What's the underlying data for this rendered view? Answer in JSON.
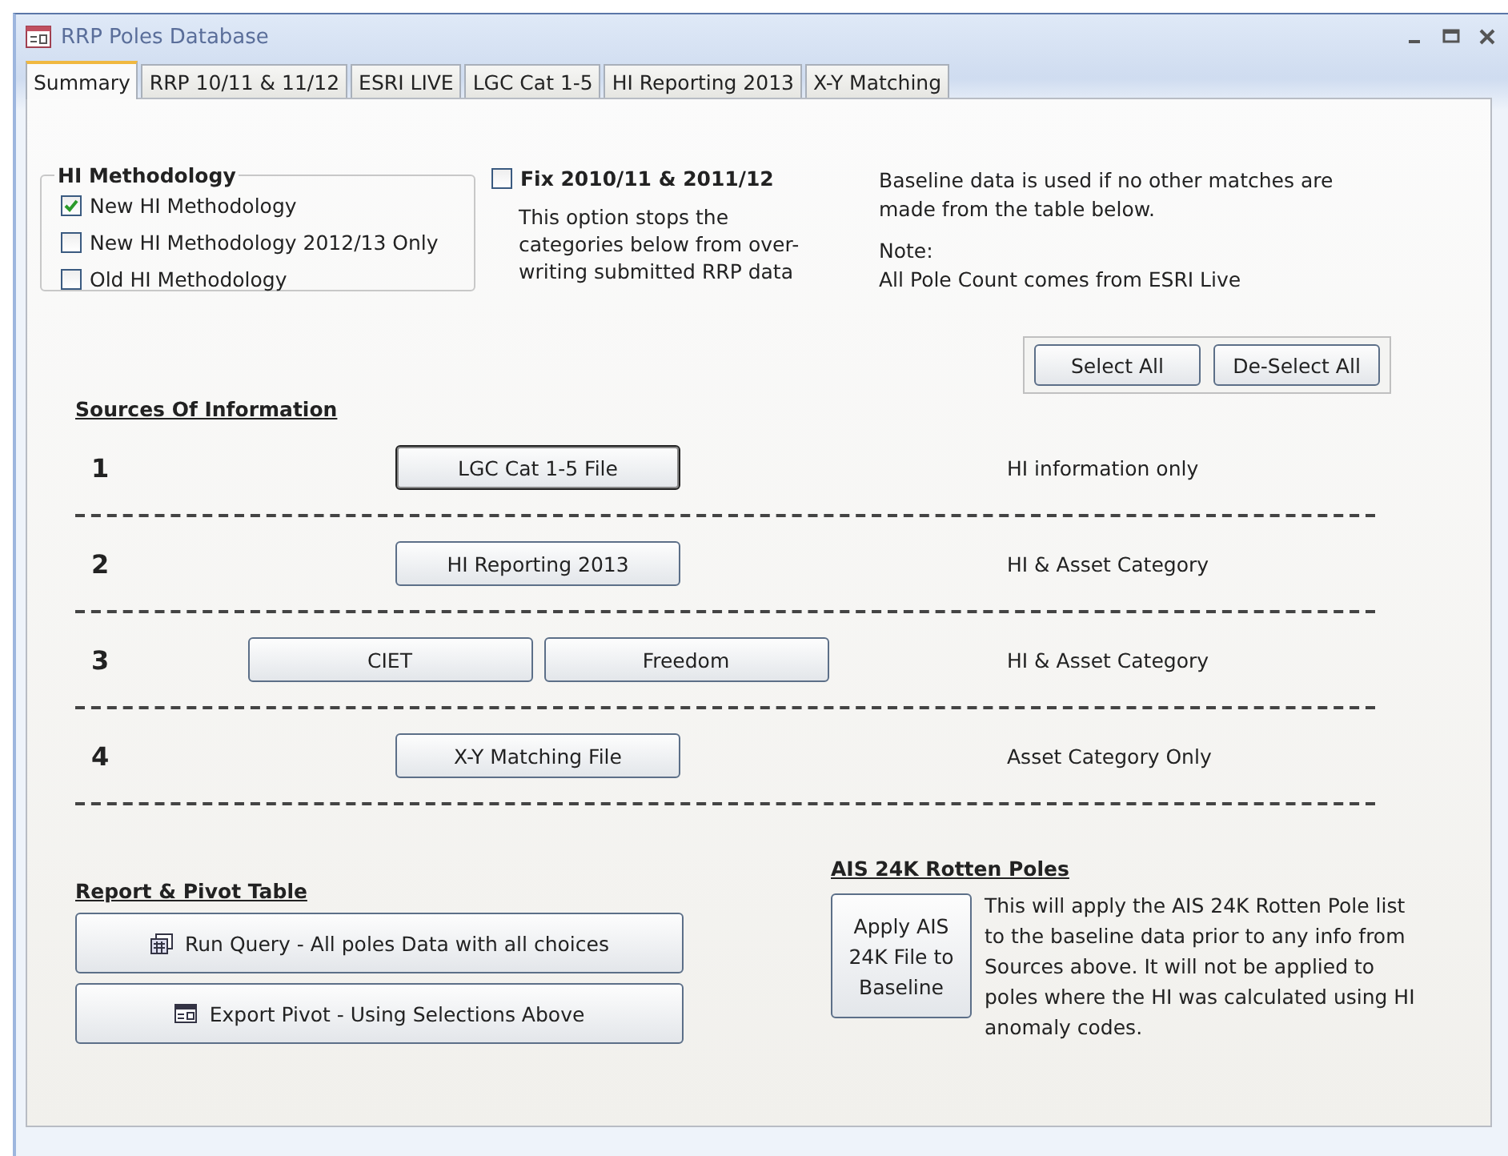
{
  "window": {
    "title": "RRP Poles Database"
  },
  "tabs": [
    {
      "label": "Summary",
      "selected": true
    },
    {
      "label": "RRP 10/11 & 11/12",
      "selected": false
    },
    {
      "label": "ESRI LIVE",
      "selected": false
    },
    {
      "label": "LGC Cat 1-5",
      "selected": false
    },
    {
      "label": "HI Reporting 2013",
      "selected": false
    },
    {
      "label": "X-Y Matching",
      "selected": false
    }
  ],
  "methodology": {
    "title": "HI Methodology",
    "options": [
      {
        "label": "New HI Methodology",
        "checked": true
      },
      {
        "label": "New HI Methodology 2012/13 Only",
        "checked": false
      },
      {
        "label": "Old HI Methodology",
        "checked": false
      }
    ]
  },
  "fix": {
    "label": "Fix 2010/11 & 2011/12",
    "checked": false,
    "description": "This option stops the categories below from over-writing submitted RRP data"
  },
  "baseline_note": "Baseline data is used if no other matches are made from the table below.",
  "note": {
    "title": "Note:",
    "text": "All Pole Count comes from ESRI Live"
  },
  "select_buttons": [
    "Select All",
    "De-Select All"
  ],
  "sources": {
    "heading": "Sources Of Information",
    "rows": [
      {
        "number": "1",
        "buttons": [
          "LGC Cat 1-5 File"
        ],
        "description": "HI information only"
      },
      {
        "number": "2",
        "buttons": [
          "HI Reporting 2013"
        ],
        "description": "HI & Asset Category"
      },
      {
        "number": "3",
        "buttons": [
          "CIET",
          "Freedom"
        ],
        "description": "HI & Asset Category"
      },
      {
        "number": "4",
        "buttons": [
          "X-Y Matching File"
        ],
        "description": "Asset Category Only"
      }
    ]
  },
  "report": {
    "heading": "Report & Pivot Table",
    "buttons": [
      {
        "kind": "query",
        "label": "Run Query - All poles Data with all choices"
      },
      {
        "kind": "pivot",
        "label": "Export Pivot - Using Selections Above"
      }
    ]
  },
  "ais": {
    "heading": "AIS 24K Rotten Poles",
    "button": "Apply AIS 24K File to Baseline",
    "description": "This will apply the AIS 24K Rotten Pole list to the baseline data prior to any info from Sources above. It will not be applied to poles where the HI was calculated using HI anomaly codes."
  }
}
